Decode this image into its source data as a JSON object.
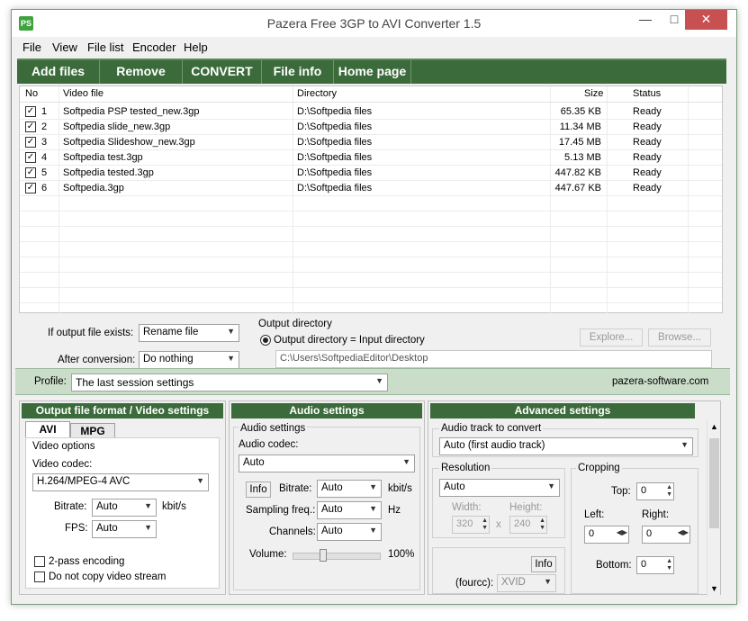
{
  "title": "Pazera Free 3GP to AVI Converter 1.5",
  "app_icon_text": "PS",
  "menu": [
    "File",
    "View",
    "File list",
    "Encoder",
    "Help"
  ],
  "toolbar": [
    "Add files",
    "Remove",
    "CONVERT",
    "File info",
    "Home page"
  ],
  "list": {
    "headers": [
      "No",
      "Video file",
      "Directory",
      "Size",
      "Status"
    ],
    "rows": [
      {
        "no": "1",
        "file": "Softpedia PSP tested_new.3gp",
        "dir": "D:\\Softpedia files",
        "size": "65.35 KB",
        "status": "Ready"
      },
      {
        "no": "2",
        "file": "Softpedia slide_new.3gp",
        "dir": "D:\\Softpedia files",
        "size": "11.34 MB",
        "status": "Ready"
      },
      {
        "no": "3",
        "file": "Softpedia Slideshow_new.3gp",
        "dir": "D:\\Softpedia files",
        "size": "17.45 MB",
        "status": "Ready"
      },
      {
        "no": "4",
        "file": "Softpedia test.3gp",
        "dir": "D:\\Softpedia files",
        "size": "5.13 MB",
        "status": "Ready"
      },
      {
        "no": "5",
        "file": "Softpedia tested.3gp",
        "dir": "D:\\Softpedia files",
        "size": "447.82 KB",
        "status": "Ready"
      },
      {
        "no": "6",
        "file": "Softpedia.3gp",
        "dir": "D:\\Softpedia files",
        "size": "447.67 KB",
        "status": "Ready"
      }
    ]
  },
  "options": {
    "if_exists_label": "If output file exists:",
    "if_exists_value": "Rename file",
    "after_conv_label": "After conversion:",
    "after_conv_value": "Do nothing",
    "outdir_title": "Output directory",
    "outdir_radio": "Output directory = Input directory",
    "outdir_path": "C:\\Users\\SoftpediaEditor\\Desktop",
    "explore": "Explore...",
    "browse": "Browse..."
  },
  "profile": {
    "label": "Profile:",
    "value": "The last session settings",
    "site": "pazera-software.com"
  },
  "video": {
    "header": "Output file format / Video settings",
    "tabs": [
      "AVI",
      "MPG"
    ],
    "group": "Video options",
    "codec_label": "Video codec:",
    "codec_value": "H.264/MPEG-4 AVC",
    "bitrate_label": "Bitrate:",
    "bitrate_value": "Auto",
    "bitrate_unit": "kbit/s",
    "fps_label": "FPS:",
    "fps_value": "Auto",
    "twopass": "2-pass encoding",
    "nocopy": "Do not copy video stream"
  },
  "audio": {
    "header": "Audio settings",
    "group": "Audio settings",
    "codec_label": "Audio codec:",
    "codec_value": "Auto",
    "info": "Info",
    "bitrate_label": "Bitrate:",
    "bitrate_value": "Auto",
    "bitrate_unit": "kbit/s",
    "freq_label": "Sampling freq.:",
    "freq_value": "Auto",
    "freq_unit": "Hz",
    "channels_label": "Channels:",
    "channels_value": "Auto",
    "volume_label": "Volume:",
    "volume_value": "100%"
  },
  "advanced": {
    "header": "Advanced settings",
    "track_label": "Audio track to convert",
    "track_value": "Auto (first audio track)",
    "resolution_label": "Resolution",
    "resolution_value": "Auto",
    "width_label": "Width:",
    "width_value": "320",
    "height_label": "Height:",
    "height_value": "240",
    "x": "x",
    "cropping_label": "Cropping",
    "top_label": "Top:",
    "top_value": "0",
    "left_label": "Left:",
    "left_value": "0",
    "right_label": "Right:",
    "right_value": "0",
    "bottom_label": "Bottom:",
    "bottom_value": "0",
    "info": "Info",
    "fourcc_label": "(fourcc):",
    "fourcc_value": "XVID"
  }
}
